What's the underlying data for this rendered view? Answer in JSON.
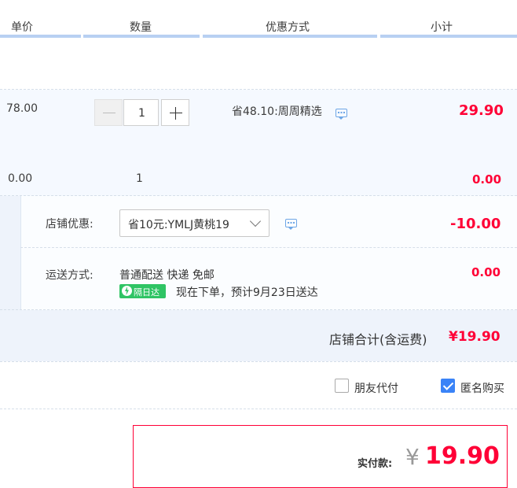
{
  "header": {
    "col_price": "单价",
    "col_qty": "数量",
    "col_discount": "优惠方式",
    "col_subtotal": "小计"
  },
  "item": {
    "unit_price": "78.00",
    "quantity": "1",
    "discount_text": "省48.10:周周精选",
    "subtotal": "29.90"
  },
  "gift": {
    "unit_price": "0.00",
    "quantity": "1",
    "subtotal": "0.00"
  },
  "shop": {
    "discount_label": "店铺优惠:",
    "discount_selected": "省10元:YMLJ黄桃19",
    "discount_amount": "-10.00",
    "shipping_label": "运送方式:",
    "shipping_method": "普通配送 快递 免邮",
    "shipping_cost": "0.00",
    "next_day_badge": "隔日达",
    "delivery_estimate": "现在下单，预计9月23日送达",
    "total_label": "店铺合计(含运费)",
    "total_value": "¥19.90"
  },
  "options": {
    "friend_pay_label": "朋友代付",
    "friend_pay_checked": false,
    "anonymous_label": "匿名购买",
    "anonymous_checked": true
  },
  "payment": {
    "label": "实付款:",
    "currency": "¥",
    "amount": "19.90"
  },
  "colors": {
    "accent_red": "#ff0036",
    "header_underline": "#b8d0f2",
    "checkbox_blue": "#3a83f7",
    "badge_green": "#2fc464"
  },
  "icons": {
    "message": "speech-bubble-icon",
    "bolt": "lightning-icon",
    "dropdown": "chevron-down-icon",
    "minus": "minus-icon",
    "plus": "plus-icon",
    "check": "check-icon"
  }
}
